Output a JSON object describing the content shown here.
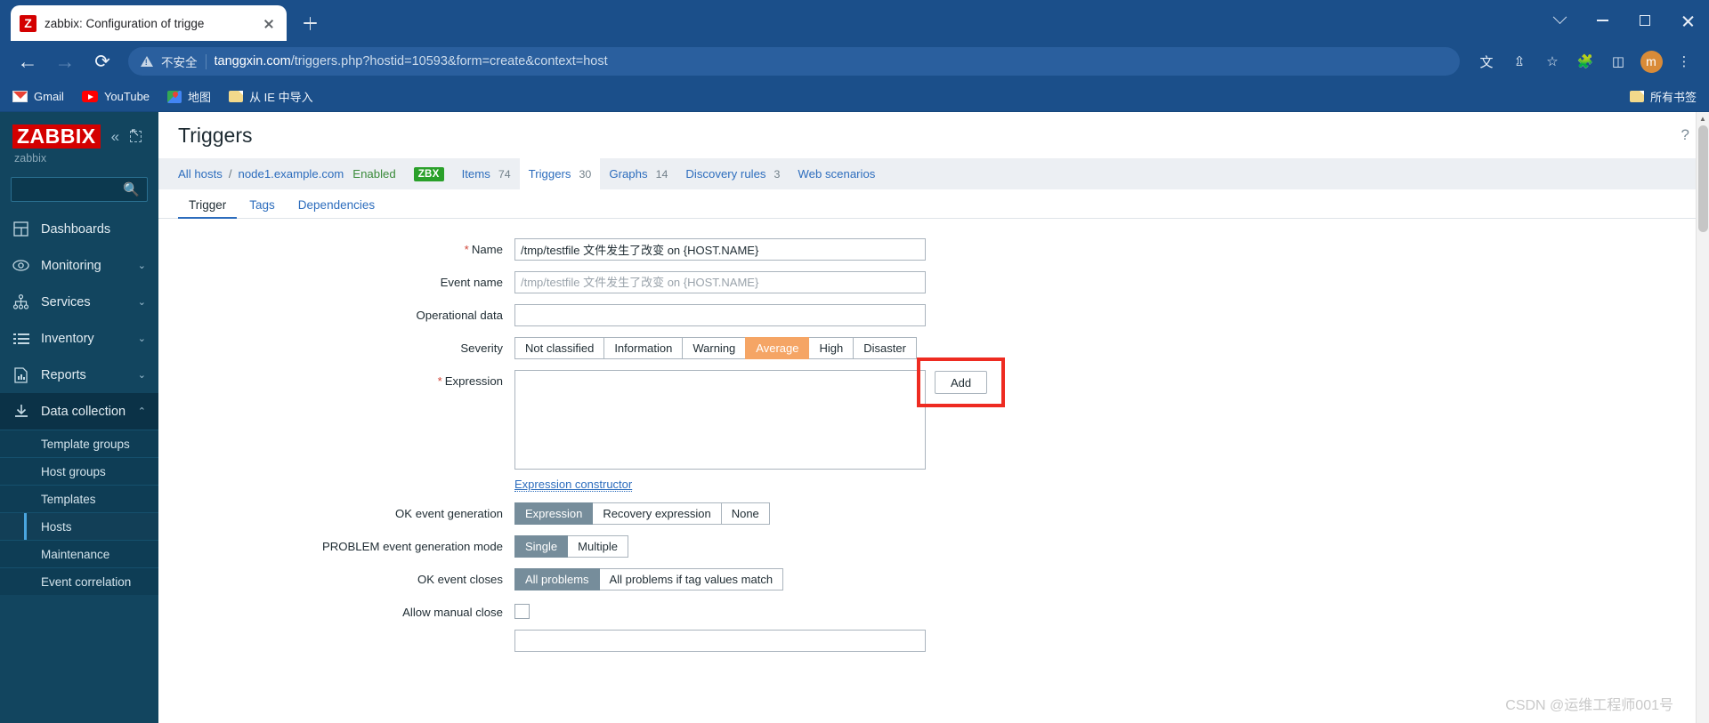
{
  "browser": {
    "tab": {
      "title": "zabbix: Configuration of trigge",
      "favicon_letter": "Z"
    },
    "newtab_label": "+",
    "window_controls": {
      "minimize": "minimize-icon",
      "maximize": "maximize-icon",
      "close": "close-icon",
      "more_tabs": "chevron-down-icon"
    },
    "nav": {
      "back": "back-arrow-icon",
      "forward": "forward-arrow-icon",
      "reload": "reload-icon"
    },
    "omnibox": {
      "security_label": "不安全",
      "url_host": "tanggxin.com",
      "url_path": "/triggers.php?hostid=10593&form=create&context=host"
    },
    "toolbar_icons": [
      "translate-icon",
      "share-icon",
      "star-icon",
      "extensions-icon",
      "sidepanel-icon",
      "profile-avatar",
      "more-menu-icon"
    ],
    "profile_letter": "m",
    "bookmarks": [
      {
        "label": "Gmail",
        "icon": "gmail-icon"
      },
      {
        "label": "YouTube",
        "icon": "youtube-icon"
      },
      {
        "label": "地图",
        "icon": "maps-icon"
      },
      {
        "label": "从 IE 中导入",
        "icon": "folder-icon"
      }
    ],
    "bookmarks_right": {
      "label": "所有书签",
      "icon": "folder-icon"
    }
  },
  "sidebar": {
    "logo": "ZABBIX",
    "server_name": "zabbix",
    "collapse_icon": "collapse-icon",
    "expand_icon": "expand-icon",
    "search_placeholder": "",
    "search_icon": "search-icon",
    "items": [
      {
        "label": "Dashboards",
        "icon": "dashboard-icon",
        "chevron": ""
      },
      {
        "label": "Monitoring",
        "icon": "eye-icon",
        "chevron": "⌄"
      },
      {
        "label": "Services",
        "icon": "services-tree-icon",
        "chevron": "⌄"
      },
      {
        "label": "Inventory",
        "icon": "list-icon",
        "chevron": "⌄"
      },
      {
        "label": "Reports",
        "icon": "report-icon",
        "chevron": "⌄"
      },
      {
        "label": "Data collection",
        "icon": "download-icon",
        "chevron": "⌃"
      }
    ],
    "subitems": [
      {
        "label": "Template groups"
      },
      {
        "label": "Host groups"
      },
      {
        "label": "Templates"
      },
      {
        "label": "Hosts"
      },
      {
        "label": "Maintenance"
      },
      {
        "label": "Event correlation"
      }
    ]
  },
  "page": {
    "title": "Triggers",
    "help_icon": "help-icon",
    "breadcrumb": {
      "all_hosts": "All hosts",
      "separator": "/",
      "host": "node1.example.com",
      "status": "Enabled",
      "agent_badge": "ZBX",
      "links": [
        {
          "label": "Items",
          "count": "74",
          "active": false
        },
        {
          "label": "Triggers",
          "count": "30",
          "active": true
        },
        {
          "label": "Graphs",
          "count": "14",
          "active": false
        },
        {
          "label": "Discovery rules",
          "count": "3",
          "active": false
        },
        {
          "label": "Web scenarios",
          "count": "",
          "active": false
        }
      ]
    },
    "form_tabs": [
      {
        "label": "Trigger",
        "active": true
      },
      {
        "label": "Tags",
        "active": false
      },
      {
        "label": "Dependencies",
        "active": false
      }
    ]
  },
  "form": {
    "name": {
      "label": "Name",
      "required": true,
      "value": "/tmp/testfile 文件发生了改变 on {HOST.NAME}"
    },
    "event_name": {
      "label": "Event name",
      "value": "",
      "placeholder": "/tmp/testfile 文件发生了改变 on {HOST.NAME}"
    },
    "operational_data": {
      "label": "Operational data",
      "value": ""
    },
    "severity": {
      "label": "Severity",
      "options": [
        "Not classified",
        "Information",
        "Warning",
        "Average",
        "High",
        "Disaster"
      ],
      "selected": "Average",
      "selected_color": "#f5a565"
    },
    "expression": {
      "label": "Expression",
      "required": true,
      "value": "",
      "add_button": "Add",
      "constructor_link": "Expression constructor",
      "highlight_color": "#ee2b21"
    },
    "ok_event_generation": {
      "label": "OK event generation",
      "options": [
        "Expression",
        "Recovery expression",
        "None"
      ],
      "selected": "Expression"
    },
    "problem_event_generation_mode": {
      "label": "PROBLEM event generation mode",
      "options": [
        "Single",
        "Multiple"
      ],
      "selected": "Single"
    },
    "ok_event_closes": {
      "label": "OK event closes",
      "options": [
        "All problems",
        "All problems if tag values match"
      ],
      "selected": "All problems"
    },
    "allow_manual_close": {
      "label": "Allow manual close",
      "checked": false
    }
  },
  "watermark": "CSDN @运维工程师001号"
}
